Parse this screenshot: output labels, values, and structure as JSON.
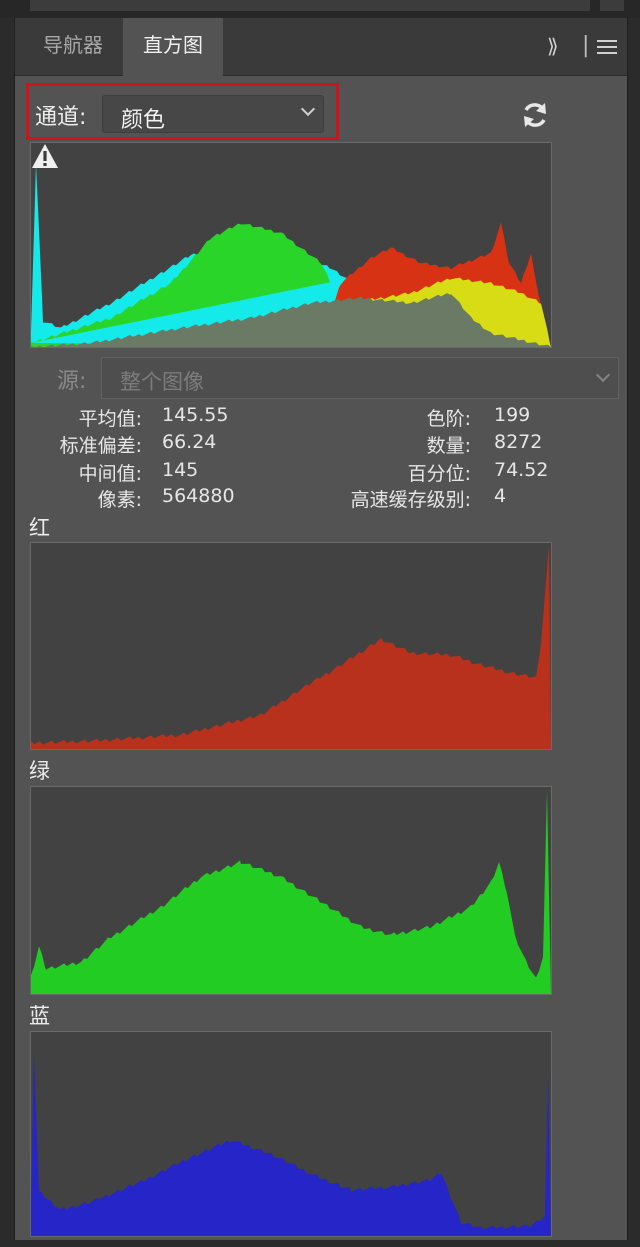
{
  "tabs": [
    {
      "label": "导航器",
      "active": false
    },
    {
      "label": "直方图",
      "active": true
    }
  ],
  "controls": {
    "collapse_icon": "double-chevron-right-icon",
    "menu_icon": "hamburger-menu-icon"
  },
  "channel": {
    "label": "通道:",
    "value": "颜色"
  },
  "source": {
    "label": "源:",
    "value": "整个图像"
  },
  "stats": {
    "mean_label": "平均值:",
    "mean": "145.55",
    "std_label": "标准偏差:",
    "std": "66.24",
    "median_label": "中间值:",
    "median": "145",
    "pixels_label": "像素:",
    "pixels": "564880",
    "level_label": "色阶:",
    "level": "199",
    "count_label": "数量:",
    "count": "8272",
    "percentile_label": "百分位:",
    "percentile": "74.52",
    "cache_label": "高速缓存级别:",
    "cache": "4"
  },
  "channels": {
    "red_title": "红",
    "green_title": "绿",
    "blue_title": "蓝"
  },
  "colors": {
    "highlight": "#d4111b",
    "red": "#b8311d",
    "green": "#22cc22",
    "blue": "#2525c8",
    "composite_red": "#d83214",
    "composite_green": "#2ad52a",
    "composite_cyan": "#14eaea",
    "composite_yellow": "#d8dc14",
    "composite_gray": "#6a7a64"
  }
}
